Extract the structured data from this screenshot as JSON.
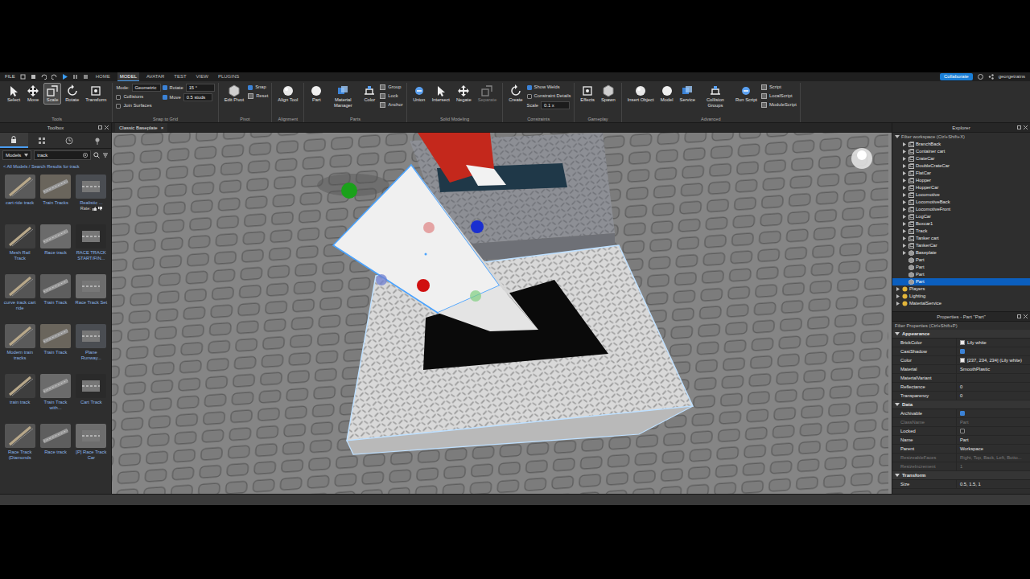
{
  "menu_bar": {
    "file": "FILE",
    "tabs": [
      {
        "label": "HOME",
        "selected": false
      },
      {
        "label": "MODEL",
        "selected": true
      },
      {
        "label": "AVATAR",
        "selected": false
      },
      {
        "label": "TEST",
        "selected": false
      },
      {
        "label": "VIEW",
        "selected": false
      },
      {
        "label": "PLUGINS",
        "selected": false
      }
    ],
    "collaborate": "Collaborate",
    "user": "georgetrains"
  },
  "ribbon": [
    {
      "label": "Tools",
      "items": [
        {
          "kind": "big",
          "label": "Select",
          "selected": false,
          "disabled": false
        },
        {
          "kind": "big",
          "label": "Move",
          "selected": false,
          "disabled": false
        },
        {
          "kind": "big",
          "label": "Scale",
          "selected": true,
          "disabled": false
        },
        {
          "kind": "big",
          "label": "Rotate",
          "selected": false,
          "disabled": false
        },
        {
          "kind": "big",
          "label": "Transform",
          "selected": false,
          "disabled": false
        }
      ]
    },
    {
      "label": "Snap to Grid",
      "items": [
        {
          "kind": "field",
          "label": "Mode:",
          "value": "Geometric"
        },
        {
          "kind": "check",
          "label": "Collisions",
          "checked": false
        },
        {
          "kind": "check",
          "label": "Join Surfaces",
          "checked": false
        },
        {
          "kind": "checkfield",
          "label": "Rotate",
          "checked": true,
          "value": "15 °"
        },
        {
          "kind": "checkfield",
          "label": "Move",
          "checked": true,
          "value": "0.5 studs"
        }
      ]
    },
    {
      "label": "Pivot",
      "items": [
        {
          "kind": "big",
          "label": "Edit Pivot",
          "selected": false,
          "disabled": false
        },
        {
          "kind": "check",
          "label": "Snap",
          "checked": true
        },
        {
          "kind": "small",
          "label": "Reset"
        }
      ]
    },
    {
      "label": "Alignment",
      "items": [
        {
          "kind": "big",
          "label": "Align Tool",
          "selected": false,
          "disabled": false
        }
      ]
    },
    {
      "label": "Parts",
      "items": [
        {
          "kind": "big",
          "label": "Part",
          "selected": false,
          "disabled": false
        },
        {
          "kind": "big",
          "label": "Material Manager",
          "selected": false,
          "disabled": false
        },
        {
          "kind": "big",
          "label": "Color",
          "selected": false,
          "disabled": false
        },
        {
          "kind": "small",
          "label": "Group"
        },
        {
          "kind": "small",
          "label": "Lock"
        },
        {
          "kind": "small",
          "label": "Anchor"
        }
      ]
    },
    {
      "label": "Solid Modeling",
      "items": [
        {
          "kind": "big",
          "label": "Union",
          "selected": false,
          "disabled": false
        },
        {
          "kind": "big",
          "label": "Intersect",
          "selected": false,
          "disabled": false
        },
        {
          "kind": "big",
          "label": "Negate",
          "selected": false,
          "disabled": false
        },
        {
          "kind": "big",
          "label": "Separate",
          "selected": false,
          "disabled": true
        }
      ]
    },
    {
      "label": "Constraints",
      "items": [
        {
          "kind": "big",
          "label": "Create",
          "selected": false,
          "disabled": false
        },
        {
          "kind": "check",
          "label": "Show Welds",
          "checked": true
        },
        {
          "kind": "check",
          "label": "Constraint Details",
          "checked": false
        },
        {
          "kind": "field",
          "label": "Scale",
          "value": "0.1 x"
        }
      ]
    },
    {
      "label": "Gameplay",
      "items": [
        {
          "kind": "big",
          "label": "Effects",
          "selected": false,
          "disabled": false
        },
        {
          "kind": "big",
          "label": "Spawn",
          "selected": false,
          "disabled": false
        }
      ]
    },
    {
      "label": "Advanced",
      "items": [
        {
          "kind": "big",
          "label": "Insert Object",
          "selected": false,
          "disabled": false
        },
        {
          "kind": "big",
          "label": "Model",
          "selected": false,
          "disabled": false
        },
        {
          "kind": "big",
          "label": "Service",
          "selected": false,
          "disabled": false
        },
        {
          "kind": "big",
          "label": "Collision Groups",
          "selected": false,
          "disabled": false
        },
        {
          "kind": "big",
          "label": "Run Script",
          "selected": false,
          "disabled": false
        },
        {
          "kind": "small",
          "label": "Script"
        },
        {
          "kind": "small",
          "label": "LocalScript"
        },
        {
          "kind": "small",
          "label": "ModuleScript"
        }
      ]
    }
  ],
  "toolbox": {
    "title": "Toolbox",
    "tabs": [
      {
        "selected": true
      },
      {
        "selected": false
      },
      {
        "selected": false
      },
      {
        "selected": false
      }
    ],
    "category": "Models",
    "search": "track",
    "breadcrumb": "< All Models / Search Results for track",
    "items": [
      {
        "label": "cart ride track"
      },
      {
        "label": "Train Tracks"
      },
      {
        "label": "Realistic ...",
        "rate": "Rate:"
      },
      {
        "label": "Mesh Rail Track"
      },
      {
        "label": "Race track"
      },
      {
        "label": "RACE TRACK START/FIN..."
      },
      {
        "label": "curve track cart ride"
      },
      {
        "label": "Train Track"
      },
      {
        "label": "Race Track Set"
      },
      {
        "label": "Modern train tracks"
      },
      {
        "label": "Train Track"
      },
      {
        "label": "Plane Runway..."
      },
      {
        "label": "train track"
      },
      {
        "label": "Train Track with..."
      },
      {
        "label": "Cart Track"
      },
      {
        "label": "Race Track (Diamonds"
      },
      {
        "label": "Race track"
      },
      {
        "label": "[P] Race Track Car"
      }
    ]
  },
  "viewport": {
    "tab": "Classic Baseplate",
    "close": "×"
  },
  "explorer": {
    "title": "Explorer",
    "filter": "Filter workspace (Ctrl+Shift+X)",
    "rows": [
      {
        "name": "BranchBack",
        "kind": "model",
        "depth": 1,
        "expandable": true,
        "selected": false
      },
      {
        "name": "Container cart",
        "kind": "model",
        "depth": 1,
        "expandable": true,
        "selected": false
      },
      {
        "name": "CrateCar",
        "kind": "model",
        "depth": 1,
        "expandable": true,
        "selected": false
      },
      {
        "name": "DoubleCrateCar",
        "kind": "model",
        "depth": 1,
        "expandable": true,
        "selected": false
      },
      {
        "name": "FlatCar",
        "kind": "model",
        "depth": 1,
        "expandable": true,
        "selected": false
      },
      {
        "name": "Hopper",
        "kind": "model",
        "depth": 1,
        "expandable": true,
        "selected": false
      },
      {
        "name": "HopperCar",
        "kind": "model",
        "depth": 1,
        "expandable": true,
        "selected": false
      },
      {
        "name": "Locomotive",
        "kind": "model",
        "depth": 1,
        "expandable": true,
        "selected": false
      },
      {
        "name": "LocomotiveBack",
        "kind": "model",
        "depth": 1,
        "expandable": true,
        "selected": false
      },
      {
        "name": "LocomotiveFront",
        "kind": "model",
        "depth": 1,
        "expandable": true,
        "selected": false
      },
      {
        "name": "LogCar",
        "kind": "model",
        "depth": 1,
        "expandable": true,
        "selected": false
      },
      {
        "name": "Boxcar1",
        "kind": "model",
        "depth": 1,
        "expandable": true,
        "selected": false
      },
      {
        "name": "Track",
        "kind": "model",
        "depth": 1,
        "expandable": true,
        "selected": false
      },
      {
        "name": "Tanker cart",
        "kind": "model",
        "depth": 1,
        "expandable": true,
        "selected": false
      },
      {
        "name": "TankerCar",
        "kind": "model",
        "depth": 1,
        "expandable": true,
        "selected": false
      },
      {
        "name": "Baseplate",
        "kind": "part",
        "depth": 1,
        "expandable": true,
        "selected": false
      },
      {
        "name": "Part",
        "kind": "part",
        "depth": 1,
        "expandable": false,
        "selected": false
      },
      {
        "name": "Part",
        "kind": "part",
        "depth": 1,
        "expandable": false,
        "selected": false
      },
      {
        "name": "Part",
        "kind": "part",
        "depth": 1,
        "expandable": false,
        "selected": false
      },
      {
        "name": "Part",
        "kind": "part",
        "depth": 1,
        "expandable": false,
        "selected": true
      },
      {
        "name": "Players",
        "kind": "service",
        "depth": 0,
        "expandable": true,
        "selected": false
      },
      {
        "name": "Lighting",
        "kind": "service",
        "depth": 0,
        "expandable": true,
        "selected": false
      },
      {
        "name": "MaterialService",
        "kind": "service",
        "depth": 0,
        "expandable": true,
        "selected": false
      }
    ]
  },
  "properties": {
    "title": "Properties - Part \"Part\"",
    "filter": "Filter Properties (Ctrl+Shift+P)",
    "sections": [
      {
        "label": "Appearance",
        "expanded": true,
        "rows": [
          {
            "name": "BrickColor",
            "kind": "color",
            "value": "Lily white",
            "color": "#edeaea",
            "disabled": false
          },
          {
            "name": "CastShadow",
            "kind": "check",
            "checked": true,
            "disabled": false
          },
          {
            "name": "Color",
            "kind": "color",
            "value": "[237, 234, 234] (Lily white)",
            "color": "#edeaea",
            "disabled": false
          },
          {
            "name": "Material",
            "kind": "text",
            "value": "SmoothPlastic",
            "disabled": false
          },
          {
            "name": "MaterialVariant",
            "kind": "text",
            "value": "",
            "disabled": false
          },
          {
            "name": "Reflectance",
            "kind": "text",
            "value": "0",
            "disabled": false
          },
          {
            "name": "Transparency",
            "kind": "text",
            "value": "0",
            "disabled": false
          }
        ]
      },
      {
        "label": "Data",
        "expanded": true,
        "rows": [
          {
            "name": "Archivable",
            "kind": "check",
            "checked": true,
            "disabled": false
          },
          {
            "name": "ClassName",
            "kind": "text",
            "value": "Part",
            "disabled": true
          },
          {
            "name": "Locked",
            "kind": "check",
            "checked": false,
            "disabled": false
          },
          {
            "name": "Name",
            "kind": "text",
            "value": "Part",
            "disabled": false
          },
          {
            "name": "Parent",
            "kind": "text",
            "value": "Workspace",
            "disabled": false
          },
          {
            "name": "ResizeableFaces",
            "kind": "text",
            "value": "Right, Top, Back, Left, Botto...",
            "disabled": true
          },
          {
            "name": "ResizeIncrement",
            "kind": "text",
            "value": "1",
            "disabled": true
          }
        ]
      },
      {
        "label": "Transform",
        "expanded": true,
        "rows": [
          {
            "name": "Size",
            "kind": "text",
            "value": "0.5, 1.5, 1",
            "disabled": false
          }
        ]
      }
    ]
  }
}
